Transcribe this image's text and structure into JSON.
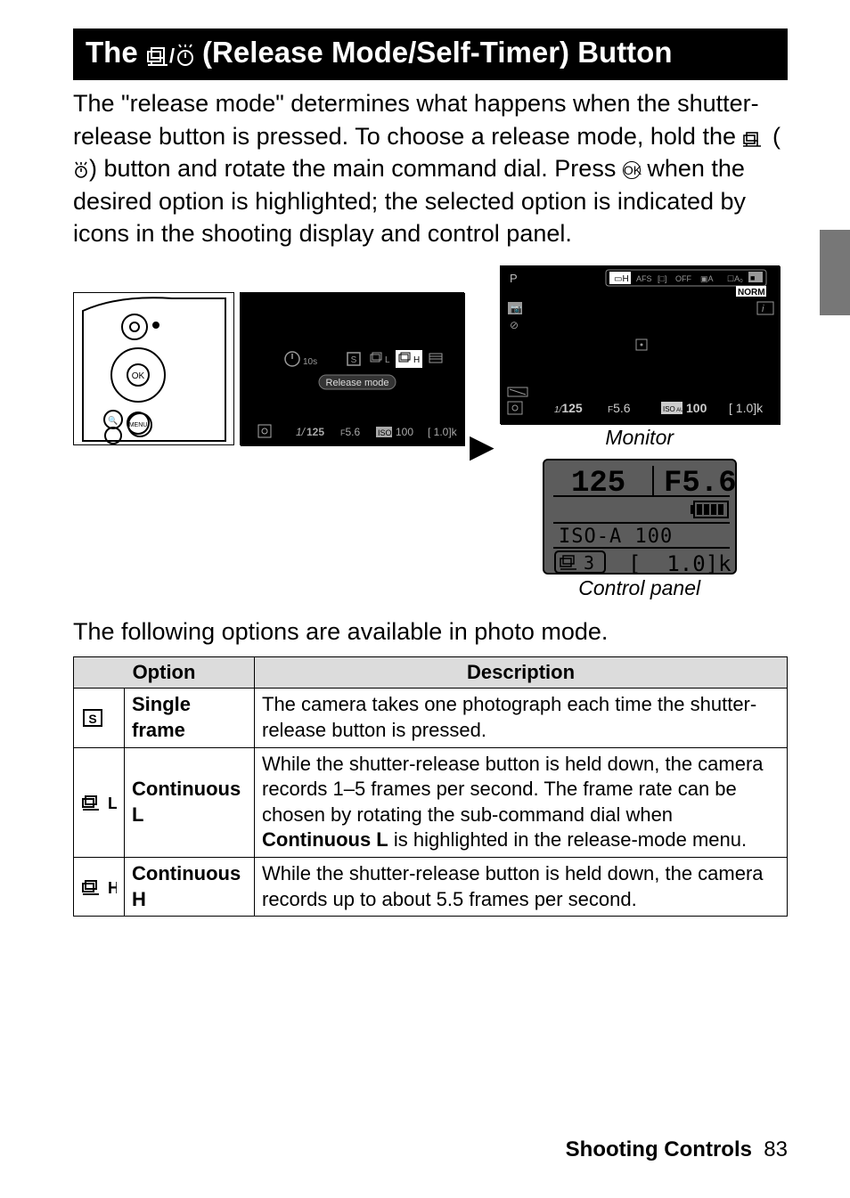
{
  "title": {
    "prefix": "The ",
    "mid": "(Release Mode/Self-Timer) Button"
  },
  "intro": {
    "line1": "The \"release mode\" determines what happens when the shutter-release button is pressed. To choose a release mode, hold the ",
    "line2_mid": " button and rotate the main command dial. Press ",
    "line2_end": " when the desired option is highlighted; the selected option is indicated by icons in the shooting display and control panel."
  },
  "menu": {
    "label": "Release mode",
    "status_shutter": "1/125",
    "status_shutter_short": "125",
    "status_f": "F5.6",
    "status_f_short": "5.6",
    "status_iso_label": "ISO",
    "status_iso": "100",
    "status_shots": "[ 1.0]k",
    "timer_icon_text": "10s"
  },
  "monitor": {
    "label": "Monitor",
    "top_mode": "P",
    "top_right": "NORM",
    "iso_box": "100",
    "iso_prefix": "ISO AUTO"
  },
  "control_panel": {
    "label": "Control panel",
    "shutter": "125",
    "aperture": "F5.6",
    "iso": "ISO-A 100",
    "burst": "3",
    "shots": "[  1.0]k"
  },
  "following": "The following options are available in photo mode.",
  "table": {
    "head_option": "Option",
    "head_desc": "Description",
    "rows": [
      {
        "icon": "S",
        "name": "Single frame",
        "desc": "The camera takes one photograph each time the shutter-release button is pressed."
      },
      {
        "icon": "L",
        "name": "Continuous L",
        "desc_a": "While the shutter-release button is held down, the camera records 1–5 frames per second. The frame rate can be chosen by rotating the sub-command dial when ",
        "desc_bold": "Continuous L",
        "desc_b": " is highlighted in the release-mode menu."
      },
      {
        "icon": "H",
        "name": "Continuous H",
        "desc": "While the shutter-release button is held down, the camera records up to about 5.5 frames per second."
      }
    ]
  },
  "footer": {
    "label": "Shooting Controls",
    "page": "83"
  }
}
